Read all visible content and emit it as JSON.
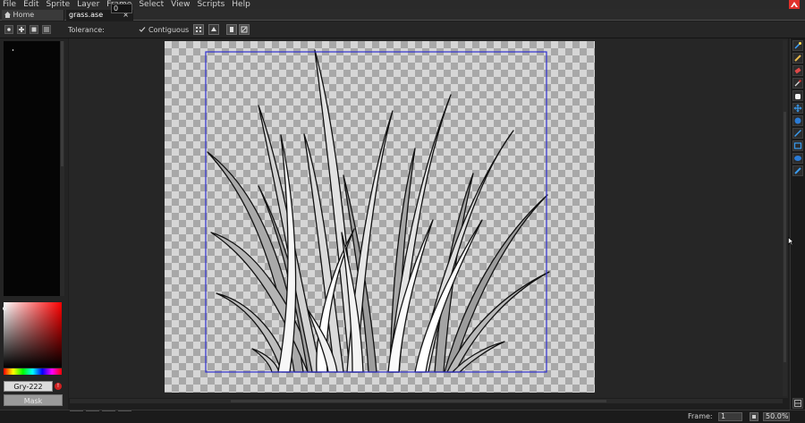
{
  "menu": [
    {
      "label": "File",
      "name": "menu-file"
    },
    {
      "label": "Edit",
      "name": "menu-edit"
    },
    {
      "label": "Sprite",
      "name": "menu-sprite"
    },
    {
      "label": "Layer",
      "name": "menu-layer"
    },
    {
      "label": "Frame",
      "name": "menu-frame"
    },
    {
      "label": "Select",
      "name": "menu-select"
    },
    {
      "label": "View",
      "name": "menu-view"
    },
    {
      "label": "Scripts",
      "name": "menu-scripts"
    },
    {
      "label": "Help",
      "name": "menu-help"
    }
  ],
  "tabs": [
    {
      "label": "Home",
      "icon": "home-icon"
    },
    {
      "label": "grass.ase",
      "close": "×",
      "active": true
    }
  ],
  "context": {
    "tolerance_label": "Tolerance:",
    "tolerance_value": "0",
    "contiguous_label": "Contiguous",
    "contiguous_checked": true
  },
  "color_bar": {
    "color_name": "Gry-222",
    "mask_label": "Mask",
    "warning_glyph": "!"
  },
  "status": {
    "frame_label": "Frame:",
    "frame_value": "1",
    "zoom_value": "50.0%"
  },
  "tools": [
    "magic-wand-icon",
    "pencil-icon",
    "eraser-icon",
    "eyedropper-icon",
    "hand-icon",
    "move-icon",
    "paint-bucket-icon",
    "line-icon",
    "rectangle-icon",
    "lasso-icon",
    "blur-icon"
  ],
  "colors": {
    "accent_blue": "#2a7bd6",
    "selection_border": "#3030d0",
    "logo_red": "#e0302a",
    "current_color": "#222222"
  }
}
